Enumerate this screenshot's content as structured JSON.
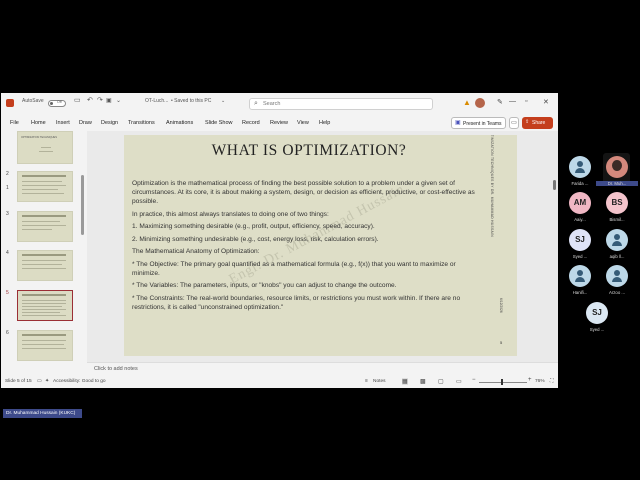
{
  "titlebar": {
    "autosave_label": "AutoSave",
    "autosave_state": "Off",
    "doc_name": "OT-Luch...",
    "save_status": "• Saved to this PC",
    "search_placeholder": "Search"
  },
  "menu": [
    "File",
    "Home",
    "Insert",
    "Draw",
    "Design",
    "Transitions",
    "Animations",
    "Slide Show",
    "Record",
    "Review",
    "View",
    "Help"
  ],
  "toolbar": {
    "present_teams": "Present in Teams",
    "share": "Share"
  },
  "thumbnails": {
    "numbers": [
      "1",
      "2",
      "3",
      "4",
      "5",
      "6"
    ],
    "first_title": "OPTIMIZATION TECHNIQUES",
    "selected": "5"
  },
  "slide": {
    "title": "WHAT IS OPTIMIZATION?",
    "paragraphs": [
      "Optimization is the mathematical process of finding the best possible solution to a problem under a given set of circumstances. At its core, it is about making a system, design, or decision as efficient, productive, or cost-effective as possible.",
      "In practice, this almost always translates to doing one of two things:",
      "1. Maximizing something desirable (e.g., profit, output, efficiency, speed, accuracy).",
      "2. Minimizing something undesirable (e.g., cost, energy loss, risk, calculation errors).",
      "The Mathematical Anatomy of Optimization:",
      "* The Objective: The primary goal quantified as a mathematical formula (e.g., f(x)) that you want to maximize or minimize.",
      "* The Variables: The parameters, inputs, or \"knobs\" you can adjust to change the outcome.",
      "* The Constraints: The real-world boundaries, resource limits, or restrictions you must work within. If there are no restrictions, it is called \"unconstrained optimization.\""
    ],
    "vertical_text": "OPTIMIZATION TECHNIQUES BY DR. MUHAMMAD HUSSAIN",
    "date_text": "6/12/2026",
    "number": "5",
    "watermark": "Engr. Dr. Muhammad Hussain"
  },
  "notes_placeholder": "Click to add notes",
  "status": {
    "slide_info": "Slide 5 of 15",
    "accessibility": "Accessibility: Good to go",
    "notes": "Notes",
    "zoom": "76%"
  },
  "presenter_tag": "Dr. Muhammad Hussain (KUKC)",
  "participants": [
    {
      "name": "Farida ...",
      "initials": "",
      "kind": "icon"
    },
    {
      "name": "Dr. Muh...",
      "initials": "",
      "kind": "photo"
    },
    {
      "name": "Aaiy...",
      "initials": "AM",
      "color": "#f0b7c4"
    },
    {
      "name": "Bismil...",
      "initials": "BS",
      "color": "#f4c4cc"
    },
    {
      "name": "Syed ...",
      "initials": "SJ",
      "color": "#dfe3f7"
    },
    {
      "name": "aqib ll...",
      "initials": "",
      "kind": "icon"
    },
    {
      "name": "Hanifi...",
      "initials": "",
      "kind": "icon"
    },
    {
      "name": "Arzoo ...",
      "initials": "",
      "kind": "icon"
    },
    {
      "name": "Syed ...",
      "initials": "SJ",
      "color": "#dbe7f2"
    }
  ]
}
